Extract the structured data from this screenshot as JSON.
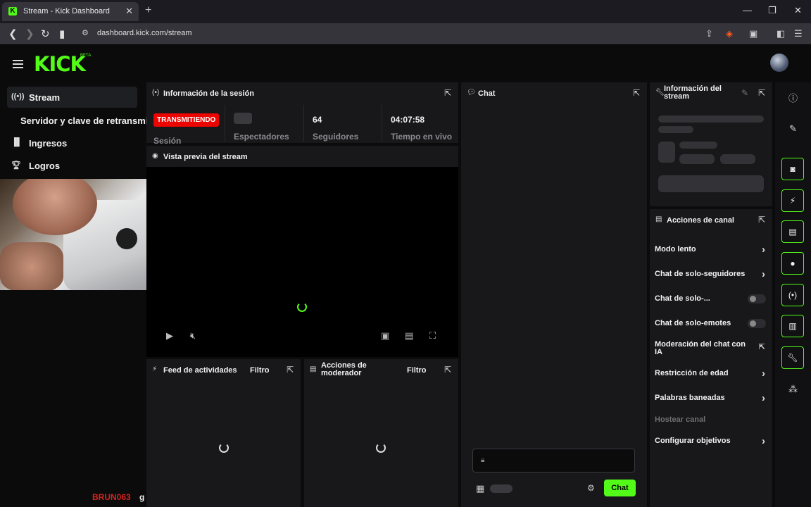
{
  "browser": {
    "tab_title": "Stream - Kick Dashboard",
    "tab_favicon": "K",
    "url": "dashboard.kick.com/stream"
  },
  "brand": {
    "logo": "KICK",
    "beta": "BETA",
    "accent": "#53fc18"
  },
  "sidebar": {
    "items": [
      {
        "label": "Stream",
        "icon": "broadcast-icon"
      },
      {
        "label": "Servidor y clave de retransmisión",
        "icon": ""
      },
      {
        "label": "Ingresos",
        "icon": "chart-icon"
      },
      {
        "label": "Logros",
        "icon": "trophy-icon"
      }
    ]
  },
  "session": {
    "title": "Información de la sesión",
    "live_badge": "TRANSMITIENDO",
    "session_label": "Sesión",
    "viewers_label": "Espectadores",
    "followers_value": "64",
    "followers_label": "Seguidores",
    "uptime_value": "04:07:58",
    "uptime_label": "Tiempo en vivo"
  },
  "preview": {
    "title": "Vista previa del stream"
  },
  "feed": {
    "title": "Feed de actividades",
    "filter": "Filtro"
  },
  "mod": {
    "title": "Acciones de moderador",
    "filter": "Filtro"
  },
  "chat": {
    "title": "Chat",
    "send_label": "Chat",
    "overlay_user": "BRUN063",
    "overlay_msg": "g"
  },
  "stream_info": {
    "title": "Información del stream"
  },
  "channel_actions": {
    "title": "Acciones de canal",
    "items": [
      {
        "label": "Modo lento",
        "type": "chevron"
      },
      {
        "label": "Chat de solo-seguidores",
        "type": "chevron"
      },
      {
        "label": "Chat de solo-...",
        "type": "toggle",
        "on": false
      },
      {
        "label": "Chat de solo-emotes",
        "type": "toggle",
        "on": false
      },
      {
        "label": "Moderación del chat con IA",
        "type": "external"
      },
      {
        "label": "Restricción de edad",
        "type": "chevron"
      },
      {
        "label": "Palabras baneadas",
        "type": "chevron"
      },
      {
        "label": "Hostear canal",
        "type": "disabled"
      },
      {
        "label": "Configurar objetivos",
        "type": "chevron"
      }
    ]
  }
}
